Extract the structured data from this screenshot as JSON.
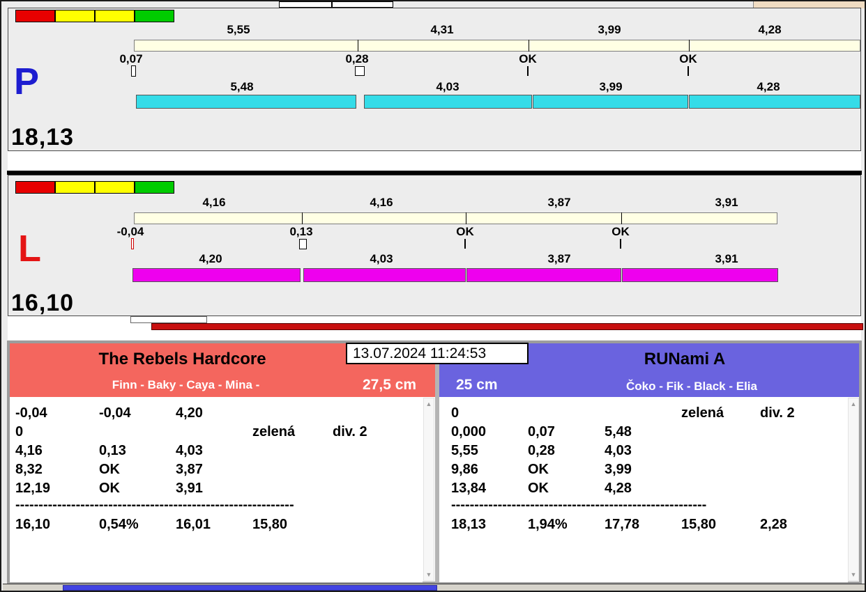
{
  "window": {
    "timestamp": "13.07.2024 11:24:53"
  },
  "icons": {
    "scroll_up": "▲",
    "scroll_down": "▼"
  },
  "colors": {
    "status_red": "#e80000",
    "status_yellow": "#ffff00",
    "status_green": "#00cc00",
    "scale_bar": "#ffffe4",
    "lane_p_bar": "#35dce8",
    "lane_l_bar": "#ee00ee",
    "lane_p_letter": "#1d1dd0",
    "lane_l_letter": "#e41414",
    "progress_red": "#c81010",
    "scroll_thumb": "#4244e2"
  },
  "lane_p": {
    "letter": "P",
    "total": "18,13",
    "top_labels": [
      "5,55",
      "4,31",
      "3,99",
      "4,28"
    ],
    "mid_labels": [
      "0,07",
      "0,28",
      "OK",
      "OK"
    ],
    "bottom_labels": [
      "5,48",
      "4,03",
      "3,99",
      "4,28"
    ]
  },
  "lane_l": {
    "letter": "L",
    "total": "16,10",
    "top_labels": [
      "4,16",
      "4,16",
      "3,87",
      "3,91"
    ],
    "mid_labels": [
      "-0,04",
      "0,13",
      "OK",
      "OK"
    ],
    "bottom_labels": [
      "4,20",
      "4,03",
      "3,87",
      "3,91"
    ]
  },
  "left_panel": {
    "team": "The Rebels Hardcore",
    "dogs": "Finn - Baky - Caya - Mina -",
    "size": "27,5 cm",
    "accent": "#f4665e",
    "rows": [
      [
        "-0,04",
        "-0,04",
        "4,20",
        "",
        ""
      ],
      [
        "0",
        "",
        "",
        "zelená",
        "div. 2"
      ],
      [
        "4,16",
        "0,13",
        "4,03",
        "",
        ""
      ],
      [
        "8,32",
        "OK",
        "3,87",
        "",
        ""
      ],
      [
        "12,19",
        "OK",
        "3,91",
        "",
        ""
      ]
    ],
    "divider": "------------------------------------------------------------",
    "total_row": [
      "16,10",
      "0,54%",
      "16,01",
      "15,80",
      ""
    ]
  },
  "right_panel": {
    "team": "RUNami A",
    "dogs": "Čoko - Fik - Black - Elia",
    "size": "25 cm",
    "accent": "#6a63df",
    "rows": [
      [
        "0",
        "",
        "",
        "zelená",
        "div. 2"
      ],
      [
        "0,000",
        "0,07",
        "5,48",
        "",
        ""
      ],
      [
        "5,55",
        "0,28",
        "4,03",
        "",
        ""
      ],
      [
        "9,86",
        "OK",
        "3,99",
        "",
        ""
      ],
      [
        "13,84",
        "OK",
        "4,28",
        "",
        ""
      ]
    ],
    "divider": "-------------------------------------------------------",
    "total_row": [
      "18,13",
      "1,94%",
      "17,78",
      "15,80",
      "2,28"
    ]
  }
}
